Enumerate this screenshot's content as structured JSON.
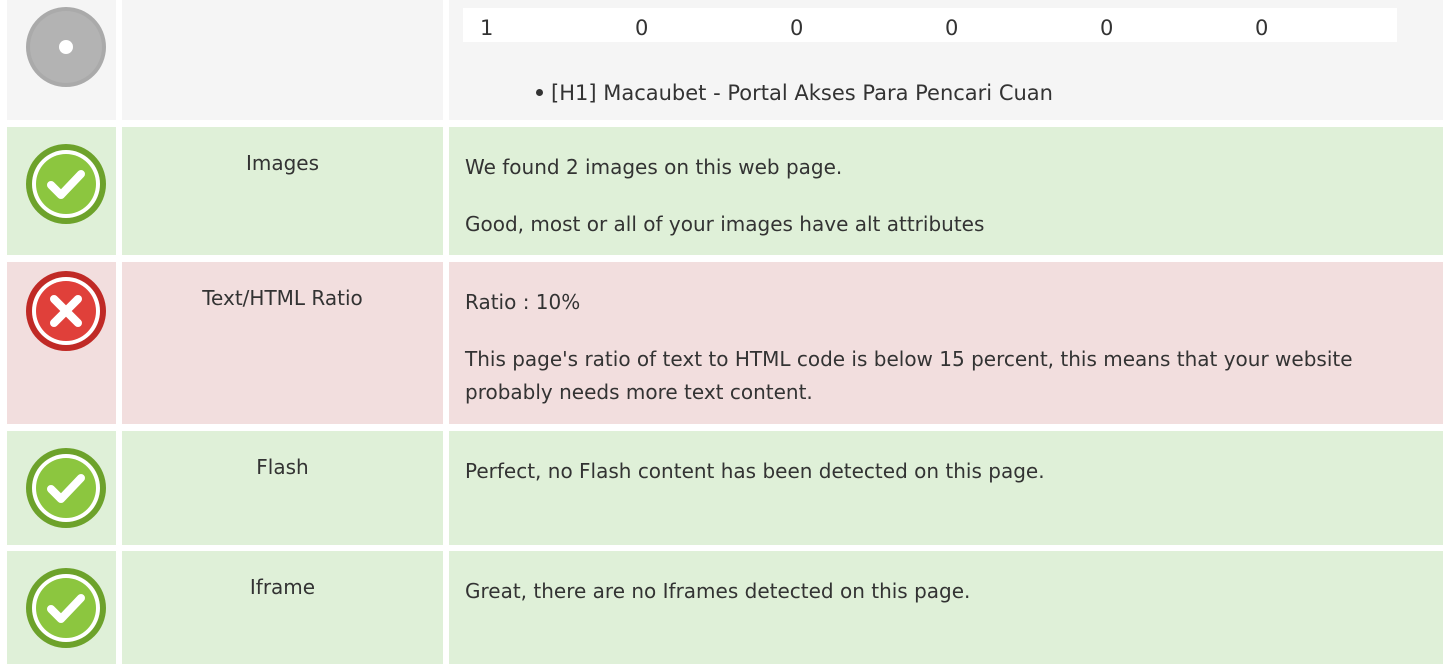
{
  "headings": {
    "counts": [
      "1",
      "0",
      "0",
      "0",
      "0",
      "0"
    ],
    "list_item": "[H1] Macaubet - Portal Akses Para Pencari Cuan"
  },
  "checks": [
    {
      "label": "Images",
      "status": "pass",
      "icon": "check-icon",
      "lines": [
        "We found 2 images on this web page.",
        "Good, most or all of your images have alt attributes"
      ]
    },
    {
      "label": "Text/HTML Ratio",
      "status": "fail",
      "icon": "cross-icon",
      "lines": [
        "Ratio : 10%",
        "This page's ratio of text to HTML code is below 15 percent, this means that your website probably needs more text content."
      ]
    },
    {
      "label": "Flash",
      "status": "pass",
      "icon": "check-icon",
      "lines": [
        "Perfect, no Flash content has been detected on this page."
      ]
    },
    {
      "label": "Iframe",
      "status": "pass",
      "icon": "check-icon",
      "lines": [
        "Great, there are no Iframes detected on this page."
      ]
    }
  ],
  "colors": {
    "pass_bg": "#dff0d8",
    "fail_bg": "#f2dede",
    "neutral_bg": "#f5f5f5",
    "pass_icon": "#8cc63f",
    "fail_icon": "#e0403a",
    "neutral_icon": "#aaaaaa"
  }
}
